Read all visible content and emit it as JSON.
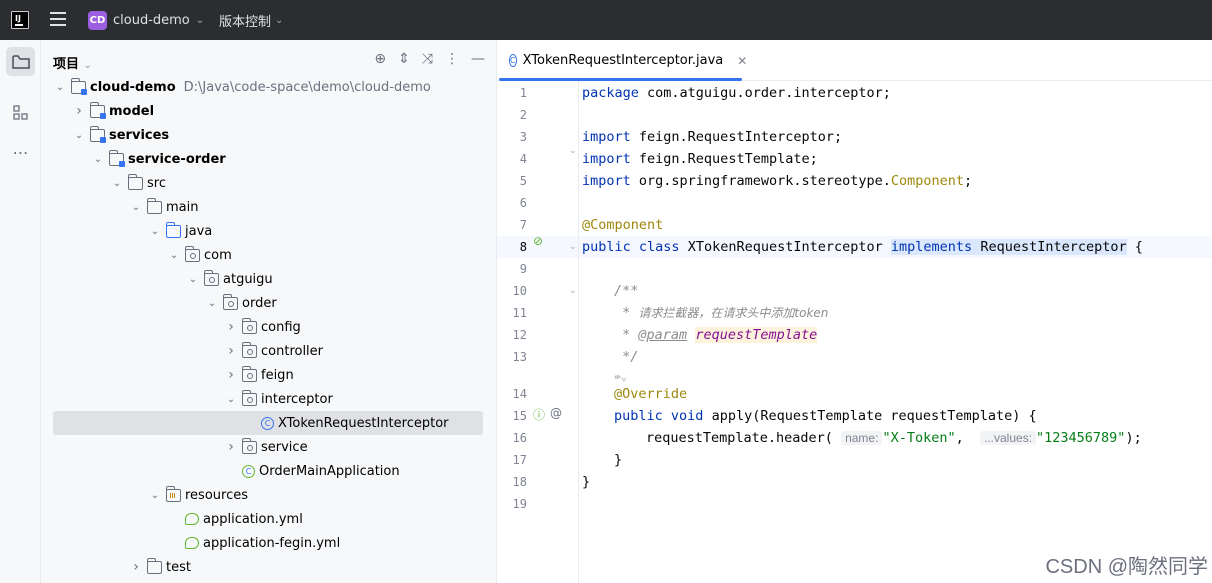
{
  "titlebar": {
    "app_logo": "IJ",
    "project_badge": "CD",
    "project_name": "cloud-demo",
    "vcs_label": "版本控制"
  },
  "project_panel": {
    "title": "项目",
    "tree": [
      {
        "label": "cloud-demo",
        "path": "D:\\Java\\code-space\\demo\\cloud-demo",
        "bold": true,
        "icon": "module-folder-icon",
        "arrow": "v",
        "indent": 0
      },
      {
        "label": "model",
        "bold": true,
        "icon": "module-folder-icon",
        "arrow": ">",
        "indent": 1
      },
      {
        "label": "services",
        "bold": true,
        "icon": "module-folder-icon",
        "arrow": "v",
        "indent": 1
      },
      {
        "label": "service-order",
        "bold": true,
        "icon": "module-folder-icon",
        "arrow": "v",
        "indent": 2
      },
      {
        "label": "src",
        "icon": "folder-icon",
        "arrow": "v",
        "indent": 3
      },
      {
        "label": "main",
        "icon": "folder-icon",
        "arrow": "v",
        "indent": 4
      },
      {
        "label": "java",
        "icon": "source-folder-icon",
        "arrow": "v",
        "indent": 5
      },
      {
        "label": "com",
        "icon": "package-icon",
        "arrow": "v",
        "indent": 6
      },
      {
        "label": "atguigu",
        "icon": "package-icon",
        "arrow": "v",
        "indent": 7
      },
      {
        "label": "order",
        "icon": "package-icon",
        "arrow": "v",
        "indent": 8
      },
      {
        "label": "config",
        "icon": "package-icon",
        "arrow": ">",
        "indent": 9
      },
      {
        "label": "controller",
        "icon": "package-icon",
        "arrow": ">",
        "indent": 9
      },
      {
        "label": "feign",
        "icon": "package-icon",
        "arrow": ">",
        "indent": 9
      },
      {
        "label": "interceptor",
        "icon": "package-icon",
        "arrow": "v",
        "indent": 9
      },
      {
        "label": "XTokenRequestInterceptor",
        "icon": "class-icon",
        "arrow": "",
        "indent": 10,
        "selected": true
      },
      {
        "label": "service",
        "icon": "package-icon",
        "arrow": ">",
        "indent": 9
      },
      {
        "label": "OrderMainApplication",
        "icon": "spring-class-icon",
        "arrow": "",
        "indent": 9
      },
      {
        "label": "resources",
        "icon": "resources-folder-icon",
        "arrow": "v",
        "indent": 5
      },
      {
        "label": "application.yml",
        "icon": "spring-yml-icon",
        "arrow": "",
        "indent": 6
      },
      {
        "label": "application-fegin.yml",
        "icon": "spring-yml-icon",
        "arrow": "",
        "indent": 6
      },
      {
        "label": "test",
        "icon": "folder-icon",
        "arrow": ">",
        "indent": 4
      }
    ]
  },
  "editor": {
    "tab_label": "XTokenRequestInterceptor.java",
    "line_numbers": [
      "1",
      "2",
      "3",
      "4",
      "5",
      "6",
      "7",
      "8",
      "9",
      "10",
      "11",
      "12",
      "13",
      "",
      "14",
      "15",
      "16",
      "17",
      "18",
      "19"
    ],
    "code": {
      "l1_kw": "package",
      "l1_rest": " com.atguigu.order.interceptor;",
      "l3_kw": "import",
      "l3_rest": " feign.RequestInterceptor;",
      "l4_kw": "import",
      "l4_rest": " feign.RequestTemplate;",
      "l5_kw": "import",
      "l5_rest": " org.springframework.stereotype.",
      "l5_cls": "Component",
      "l5_end": ";",
      "l7_ann": "@Component",
      "l8_kw1": "public",
      "l8_kw2": "class",
      "l8_name": " XTokenRequestInterceptor ",
      "l8_kw3": "implements",
      "l8_iface": "RequestInterceptor",
      "l8_end": " {",
      "l10": "/**",
      "l11_star": " * ",
      "l11_text": "请求拦截器，在请求头中添加token",
      "l12_star": " * ",
      "l12_tag": "@param",
      "l12_par": "requestTemplate",
      "l13": " */",
      "l13b": "⇎⌄",
      "l14_ann": "@Override",
      "l15_kw1": "public",
      "l15_kw2": "void",
      "l15_rest": " apply(RequestTemplate requestTemplate) {",
      "l16_call": "requestTemplate.header(",
      "l16_hint1": "name:",
      "l16_str1": "\"X-Token\"",
      "l16_comma": ", ",
      "l16_hint2": "...values:",
      "l16_str2": "\"123456789\"",
      "l16_end": ");",
      "l17": "}",
      "l18": "}"
    }
  },
  "watermark": "CSDN @陶然同学"
}
